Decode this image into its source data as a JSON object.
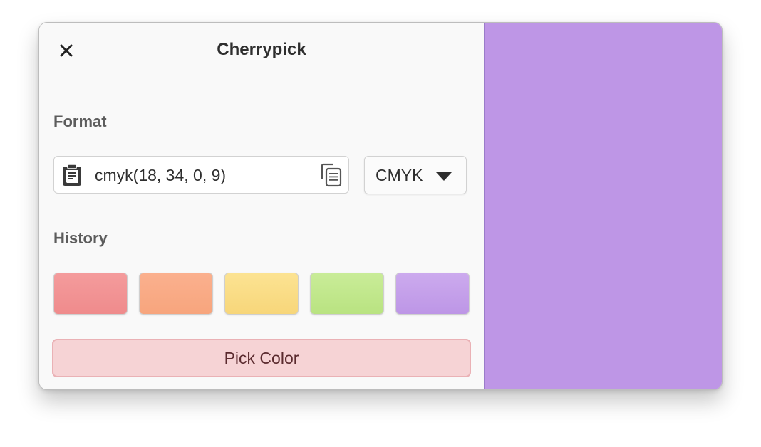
{
  "window": {
    "title": "Cherrypick"
  },
  "icons": {
    "close": "close-icon",
    "paste": "paste-icon",
    "copy": "copy-icon",
    "dropdown": "chevron-down-icon"
  },
  "format": {
    "label": "Format",
    "value": "cmyk(18, 34, 0, 9)",
    "selected_format": "CMYK"
  },
  "history": {
    "label": "History",
    "swatches": [
      {
        "color_top": "#f49b9c",
        "color_bottom": "#ef8b8c"
      },
      {
        "color_top": "#fbb08e",
        "color_bottom": "#f7a57d"
      },
      {
        "color_top": "#fce392",
        "color_bottom": "#f7d67a"
      },
      {
        "color_top": "#c9ec98",
        "color_bottom": "#b9e381"
      },
      {
        "color_top": "#ccaaee",
        "color_bottom": "#bd96e6"
      }
    ]
  },
  "preview": {
    "color": "#be96e6"
  },
  "actions": {
    "pick_label": "Pick Color"
  }
}
